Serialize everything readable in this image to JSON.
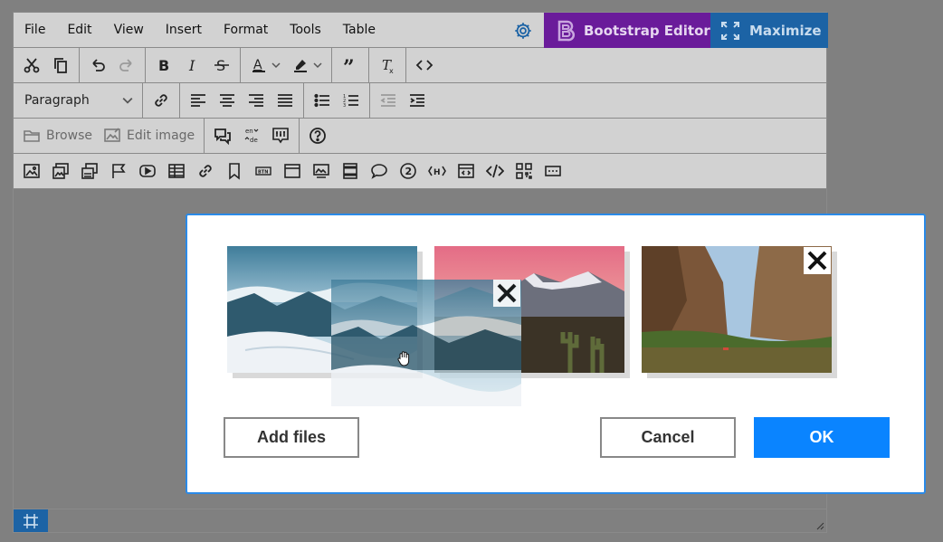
{
  "menubar": {
    "items": [
      "File",
      "Edit",
      "View",
      "Insert",
      "Format",
      "Tools",
      "Table"
    ],
    "bootstrap_editor_label": "Bootstrap Editor",
    "maximize_label": "Maximize"
  },
  "toolbar": {
    "paragraph_select": "Paragraph",
    "browse_label": "Browse",
    "edit_image_label": "Edit image",
    "lang_top": "en",
    "lang_bottom": "de"
  },
  "dialog": {
    "add_files_label": "Add files",
    "cancel_label": "Cancel",
    "ok_label": "OK",
    "images": [
      "mountain-snow",
      "desert-mountains",
      "canyon-river"
    ]
  },
  "colors": {
    "bootstrap_purple": "#6a1b9a",
    "maximize_blue": "#1c63a5",
    "primary_blue": "#0a84ff",
    "dialog_border": "#2a8ae8"
  }
}
